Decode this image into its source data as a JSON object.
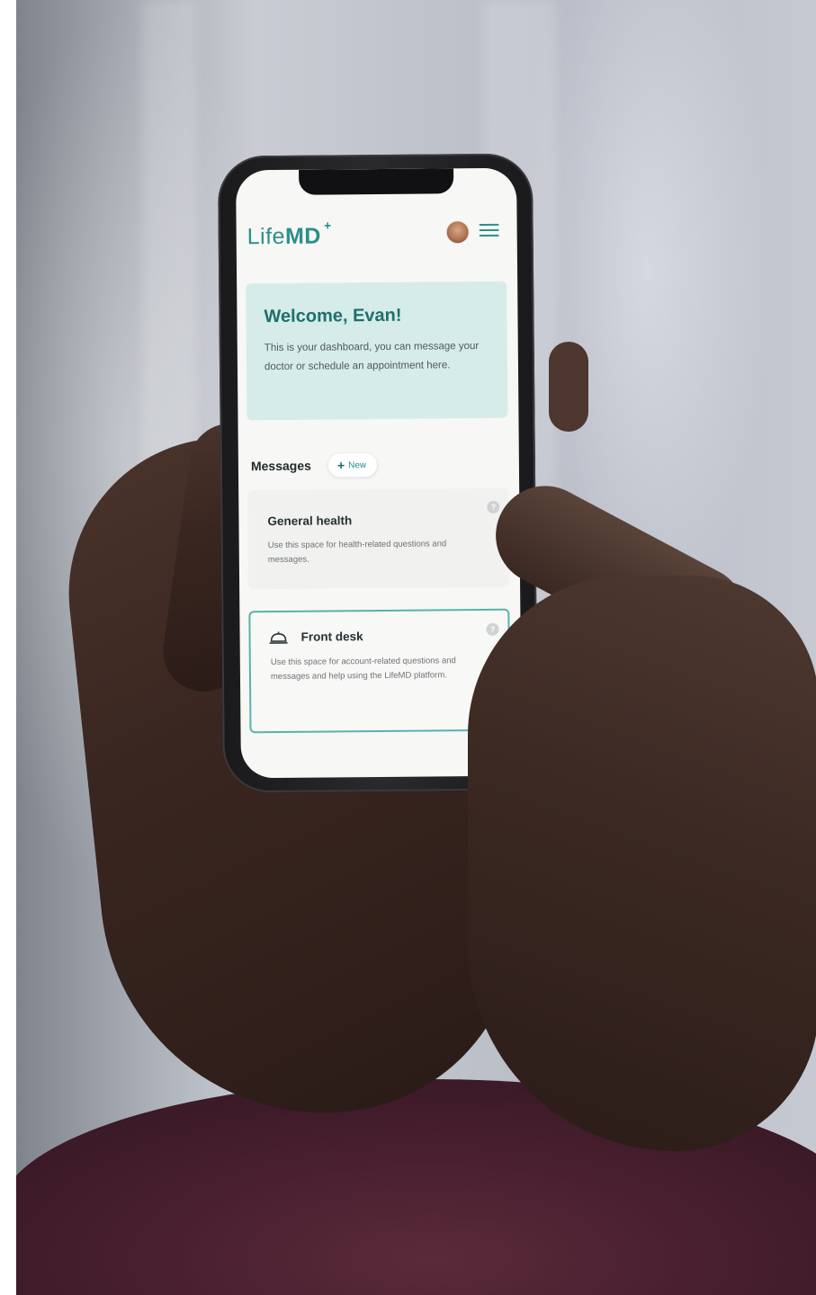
{
  "app": {
    "logo_life": "Life",
    "logo_md": "MD",
    "logo_plus": "+"
  },
  "header": {
    "avatar_icon": "user-avatar",
    "menu_icon": "hamburger-menu-icon"
  },
  "welcome": {
    "title": "Welcome, Evan!",
    "body": "This is your dashboard, you can message your doctor or schedule an appointment here."
  },
  "messages": {
    "label": "Messages",
    "new_label": "New",
    "cards": [
      {
        "title": "General health",
        "body": "Use this space for health-related questions and messages."
      },
      {
        "title": "Front desk",
        "body": "Use this space for account-related questions and messages and help using the LifeMD platform."
      }
    ]
  },
  "colors": {
    "brand_teal": "#2a8f8a",
    "welcome_bg": "#d6ece9",
    "selected_border": "#58b3ab"
  }
}
